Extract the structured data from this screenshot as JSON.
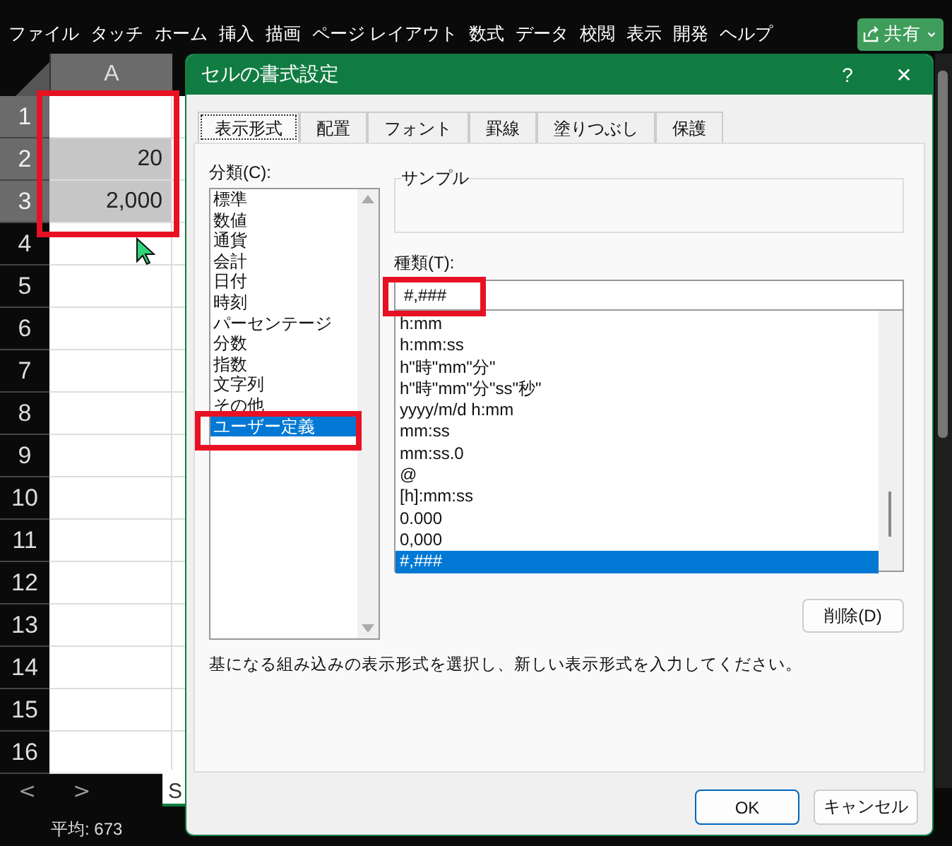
{
  "menu_tabs": [
    {
      "label": "ファイル"
    },
    {
      "label": "タッチ"
    },
    {
      "label": "ホーム"
    },
    {
      "label": "挿入"
    },
    {
      "label": "描画"
    },
    {
      "label": "ページ レイアウト"
    },
    {
      "label": "数式"
    },
    {
      "label": "データ"
    },
    {
      "label": "校閲"
    },
    {
      "label": "表示"
    },
    {
      "label": "開発"
    },
    {
      "label": "ヘルプ"
    }
  ],
  "share_button": {
    "label": "共有"
  },
  "sheet": {
    "column_header": "A",
    "rows": [
      {
        "number": "1",
        "selected": true
      },
      {
        "number": "2",
        "value": "20",
        "selected": true
      },
      {
        "number": "3",
        "value": "2,000",
        "selected": true
      },
      {
        "number": "4",
        "selected": false
      },
      {
        "number": "5",
        "selected": false
      },
      {
        "number": "6",
        "selected": false
      },
      {
        "number": "7",
        "selected": false
      },
      {
        "number": "8",
        "selected": false
      },
      {
        "number": "9",
        "selected": false
      },
      {
        "number": "10",
        "selected": false
      },
      {
        "number": "11",
        "selected": false
      },
      {
        "number": "12",
        "selected": false
      },
      {
        "number": "13",
        "selected": false
      },
      {
        "number": "14",
        "selected": false
      },
      {
        "number": "15",
        "selected": false
      },
      {
        "number": "16",
        "selected": false
      }
    ]
  },
  "sheet_tab_bar": {
    "prev": "<",
    "next": ">",
    "sheet_tab": "S"
  },
  "status_bar": {
    "average": "平均: 673"
  },
  "dialog": {
    "title": "セルの書式設定",
    "help": "?",
    "close": "✕",
    "tabs": [
      {
        "label": "表示形式",
        "selected": true
      },
      {
        "label": "配置",
        "selected": false
      },
      {
        "label": "フォント",
        "selected": false
      },
      {
        "label": "罫線",
        "selected": false
      },
      {
        "label": "塗りつぶし",
        "selected": false
      },
      {
        "label": "保護",
        "selected": false
      }
    ],
    "category_label": "分類(C):",
    "categories": [
      {
        "label": "標準",
        "selected": false
      },
      {
        "label": "数値",
        "selected": false
      },
      {
        "label": "通貨",
        "selected": false
      },
      {
        "label": "会計",
        "selected": false
      },
      {
        "label": "日付",
        "selected": false
      },
      {
        "label": "時刻",
        "selected": false
      },
      {
        "label": "パーセンテージ",
        "selected": false
      },
      {
        "label": "分数",
        "selected": false
      },
      {
        "label": "指数",
        "selected": false
      },
      {
        "label": "文字列",
        "selected": false
      },
      {
        "label": "その他",
        "selected": false
      },
      {
        "label": "ユーザー定義",
        "selected": true
      }
    ],
    "sample_label": "サンプル",
    "type_label": "種類(T):",
    "type_value": "#,###",
    "formats": [
      {
        "label": "h:mm",
        "selected": false
      },
      {
        "label": "h:mm:ss",
        "selected": false
      },
      {
        "label": "h\"時\"mm\"分\"",
        "selected": false
      },
      {
        "label": "h\"時\"mm\"分\"ss\"秒\"",
        "selected": false
      },
      {
        "label": "yyyy/m/d h:mm",
        "selected": false
      },
      {
        "label": "mm:ss",
        "selected": false
      },
      {
        "label": "mm:ss.0",
        "selected": false
      },
      {
        "label": "@",
        "selected": false
      },
      {
        "label": "[h]:mm:ss",
        "selected": false
      },
      {
        "label": "0.000",
        "selected": false
      },
      {
        "label": "0,000",
        "selected": false
      },
      {
        "label": "#,###",
        "selected": true
      }
    ],
    "delete_button": "削除(D)",
    "description": "基になる組み込みの表示形式を選択し、新しい表示形式を入力してください。",
    "buttons": [
      {
        "label": "OK",
        "kind": "default"
      },
      {
        "label": "キャンセル",
        "kind": "normal"
      }
    ]
  }
}
